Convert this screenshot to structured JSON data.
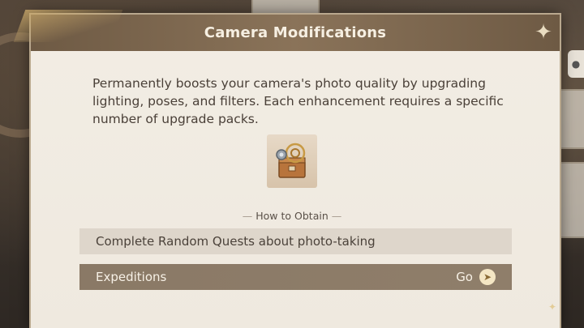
{
  "dialog": {
    "title": "Camera Modifications",
    "description": "Permanently boosts your camera's photo quality by upgrading lighting, poses, and filters. Each enhancement requires a specific number of upgrade packs.",
    "item_icon": "camera-upgrade-pack-icon",
    "close_icon": "close-star-icon"
  },
  "obtain": {
    "heading": "How to Obtain",
    "sources": [
      {
        "label": "Complete Random Quests about photo-taking"
      },
      {
        "label": "Expeditions",
        "action": "Go",
        "action_icon": "arrow-right-circle-icon"
      }
    ]
  },
  "colors": {
    "header": "#7d6850",
    "panel": "#f0ebe2",
    "source_row": "#ded6cb",
    "expedition_row": "#8c7b68"
  }
}
